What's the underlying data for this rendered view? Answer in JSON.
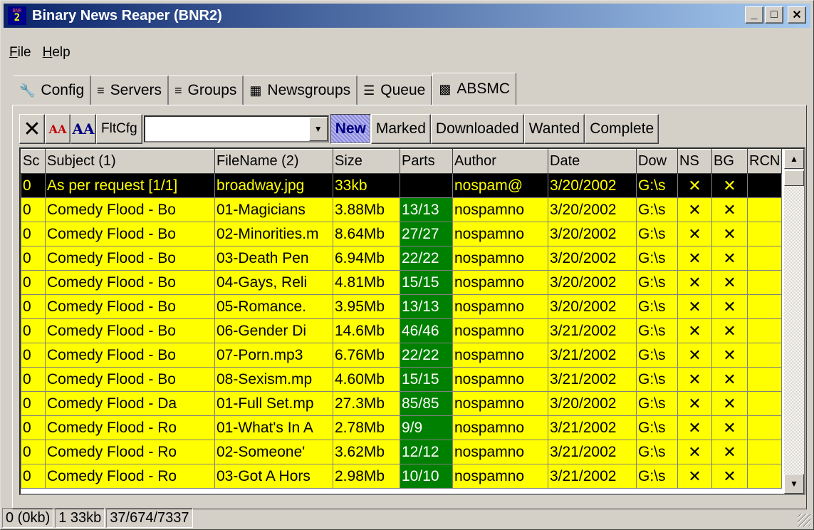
{
  "window": {
    "title": "Binary News Reaper (BNR2)",
    "icon_top": "BNR",
    "icon_bottom": "2"
  },
  "menu": [
    {
      "label": "File",
      "accel": "F"
    },
    {
      "label": "Help",
      "accel": "H"
    }
  ],
  "tabs": [
    {
      "label": "Config",
      "icon": "wrench-icon",
      "glyph": "🔧"
    },
    {
      "label": "Servers",
      "icon": "tree-icon",
      "glyph": "≡"
    },
    {
      "label": "Groups",
      "icon": "tree-icon",
      "glyph": "≡"
    },
    {
      "label": "Newsgroups",
      "icon": "list-icon",
      "glyph": "▦"
    },
    {
      "label": "Queue",
      "icon": "queue-icon",
      "glyph": "☰"
    },
    {
      "label": "ABSMC",
      "icon": "grid-icon",
      "glyph": "▩",
      "active": true
    }
  ],
  "toolbar": {
    "delete_glyph": "✕",
    "font_small": "AA",
    "font_large": "AA",
    "fltcfg": "FltCfg",
    "combo_value": "",
    "filters": [
      "New",
      "Marked",
      "Downloaded",
      "Wanted",
      "Complete"
    ],
    "pressed_filter": "New"
  },
  "columns": [
    "Sc",
    "Subject (1)",
    "FileName (2)",
    "Size",
    "Parts",
    "Author",
    "Date",
    "Dow",
    "NS",
    "BG",
    "RCN"
  ],
  "rows": [
    [
      "0",
      "As per request [1/1]",
      "broadway.jpg",
      "33kb",
      "",
      "nospam@",
      "3/20/2002",
      "G:\\s",
      "✕",
      "✕",
      ""
    ],
    [
      "0",
      "Comedy Flood - Bo",
      "01-Magicians",
      "3.88Mb",
      "13/13",
      "nospamno",
      "3/20/2002",
      "G:\\s",
      "✕",
      "✕",
      ""
    ],
    [
      "0",
      "Comedy Flood - Bo",
      "02-Minorities.m",
      "8.64Mb",
      "27/27",
      "nospamno",
      "3/20/2002",
      "G:\\s",
      "✕",
      "✕",
      ""
    ],
    [
      "0",
      "Comedy Flood - Bo",
      "03-Death Pen",
      "6.94Mb",
      "22/22",
      "nospamno",
      "3/20/2002",
      "G:\\s",
      "✕",
      "✕",
      ""
    ],
    [
      "0",
      "Comedy Flood - Bo",
      "04-Gays, Reli",
      "4.81Mb",
      "15/15",
      "nospamno",
      "3/20/2002",
      "G:\\s",
      "✕",
      "✕",
      ""
    ],
    [
      "0",
      "Comedy Flood - Bo",
      "05-Romance.",
      "3.95Mb",
      "13/13",
      "nospamno",
      "3/20/2002",
      "G:\\s",
      "✕",
      "✕",
      ""
    ],
    [
      "0",
      "Comedy Flood - Bo",
      "06-Gender Di",
      "14.6Mb",
      "46/46",
      "nospamno",
      "3/21/2002",
      "G:\\s",
      "✕",
      "✕",
      ""
    ],
    [
      "0",
      "Comedy Flood - Bo",
      "07-Porn.mp3",
      "6.76Mb",
      "22/22",
      "nospamno",
      "3/21/2002",
      "G:\\s",
      "✕",
      "✕",
      ""
    ],
    [
      "0",
      "Comedy Flood - Bo",
      "08-Sexism.mp",
      "4.60Mb",
      "15/15",
      "nospamno",
      "3/21/2002",
      "G:\\s",
      "✕",
      "✕",
      ""
    ],
    [
      "0",
      "Comedy Flood - Da",
      "01-Full Set.mp",
      "27.3Mb",
      "85/85",
      "nospamno",
      "3/20/2002",
      "G:\\s",
      "✕",
      "✕",
      ""
    ],
    [
      "0",
      "Comedy Flood - Ro",
      "01-What's In A",
      "2.78Mb",
      "9/9",
      "nospamno",
      "3/21/2002",
      "G:\\s",
      "✕",
      "✕",
      ""
    ],
    [
      "0",
      "Comedy Flood - Ro",
      "02-Someone'",
      "3.62Mb",
      "12/12",
      "nospamno",
      "3/21/2002",
      "G:\\s",
      "✕",
      "✕",
      ""
    ],
    [
      "0",
      "Comedy Flood - Ro",
      "03-Got A Hors",
      "2.98Mb",
      "10/10",
      "nospamno",
      "3/21/2002",
      "G:\\s",
      "✕",
      "✕",
      ""
    ]
  ],
  "status": [
    "0 (0kb)",
    "1  33kb",
    "37/674/7337"
  ],
  "colors": {
    "row_bg": "#ffff00",
    "parts_bg": "#008000",
    "selected_bg": "#000000",
    "titlebar": "#0a246a"
  }
}
